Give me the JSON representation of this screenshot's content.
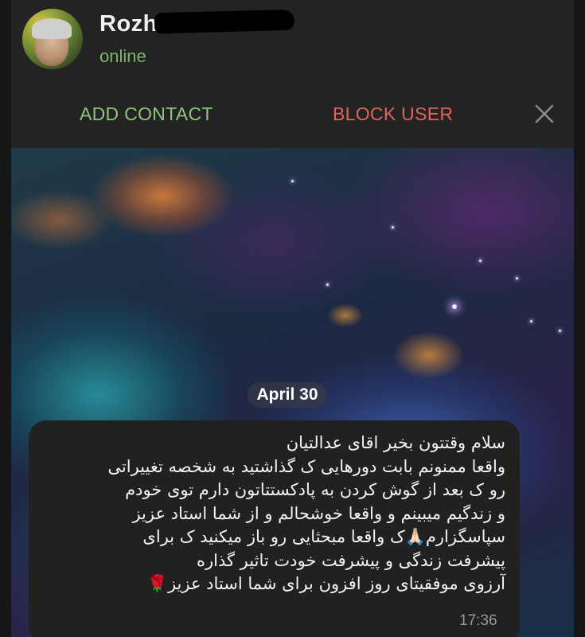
{
  "header": {
    "contact_name": "Rozh",
    "status": "online",
    "avatar_icon": "contact-avatar"
  },
  "action_bar": {
    "add_contact_label": "ADD CONTACT",
    "block_user_label": "BLOCK USER",
    "close_icon": "close-icon"
  },
  "chat": {
    "date_label": "April 30",
    "message": {
      "lines": [
        "سلام وقتتون بخیر اقای عدالتیان",
        "واقعا ممنونم بابت دورهایی ک گذاشتید به شخصه تغییراتی",
        "رو ک بعد از گوش کردن به پادکستتاتون دارم توی خودم",
        "و زندگیم میبینم و واقعا خوشحالم و از شما استاد عزیز",
        "سپاسگزارم🙏🏻ک واقعا مبحثایی رو باز میکنید ک برای",
        "پیشرفت زندگی و پیشرفت خودت تاثیر گذاره",
        "آرزوی موفقیتای روز افزون برای شما استاد عزیز🌹"
      ],
      "time": "17:36"
    }
  },
  "colors": {
    "status_online": "#7fb36f",
    "add_contact": "#93c47d",
    "block_user": "#e0645c",
    "bubble_bg": "#212121",
    "bar_bg": "#232323"
  }
}
